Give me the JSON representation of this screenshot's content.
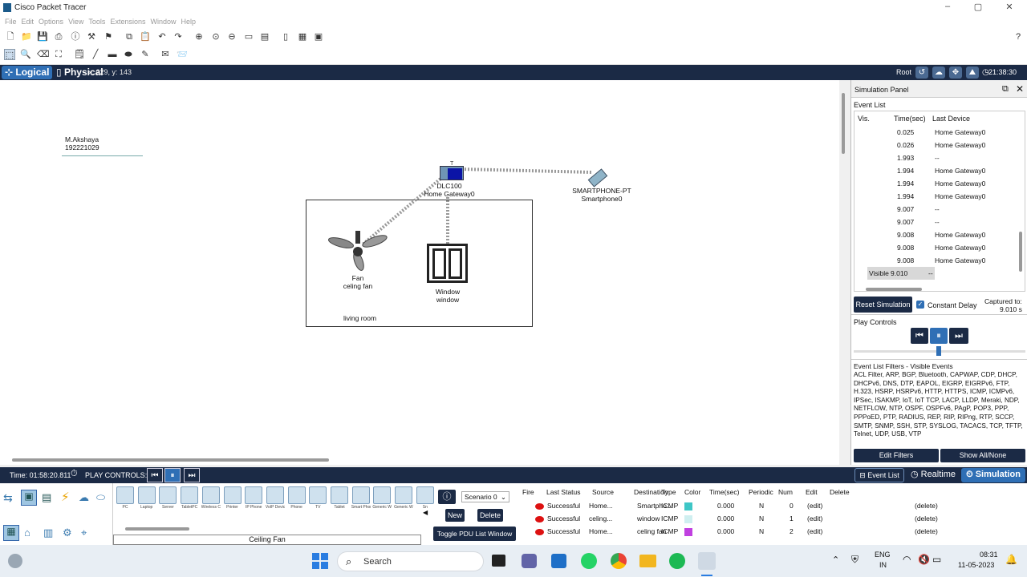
{
  "window": {
    "title": "Cisco Packet Tracer",
    "minimize": "–",
    "maximize": "▢",
    "close": "✕"
  },
  "menu": [
    "File",
    "Edit",
    "Options",
    "View",
    "Tools",
    "Extensions",
    "Window",
    "Help"
  ],
  "help_glyph": "?",
  "workspace_bar": {
    "logical": "Logical",
    "physical": "Physical",
    "coords": "x: 229, y: 143",
    "root": "Root",
    "clock": "21:38:30"
  },
  "canvas": {
    "note_line1": "M.Akshaya",
    "note_line2": "192221029",
    "room_label": "living room",
    "gateway": {
      "model": "DLC100",
      "name": "Home Gateway0"
    },
    "smartphone": {
      "model": "SMARTPHONE-PT",
      "name": "Smartphone0"
    },
    "fan": {
      "model": "Fan",
      "name": "celing fan"
    },
    "window_dev": {
      "model": "Window",
      "name": "window"
    },
    "gateway_label_t": "T"
  },
  "simulation": {
    "panel_title": "Simulation Panel",
    "event_list_title": "Event List",
    "columns": [
      "Vis.",
      "Time(sec)",
      "Last Device"
    ],
    "events": [
      {
        "vis": "",
        "time": "0.025",
        "device": "Home Gateway0"
      },
      {
        "vis": "",
        "time": "0.026",
        "device": "Home Gateway0"
      },
      {
        "vis": "",
        "time": "1.993",
        "device": "--"
      },
      {
        "vis": "",
        "time": "1.994",
        "device": "Home Gateway0"
      },
      {
        "vis": "",
        "time": "1.994",
        "device": "Home Gateway0"
      },
      {
        "vis": "",
        "time": "1.994",
        "device": "Home Gateway0"
      },
      {
        "vis": "",
        "time": "9.007",
        "device": "--"
      },
      {
        "vis": "",
        "time": "9.007",
        "device": "--"
      },
      {
        "vis": "",
        "time": "9.008",
        "device": "Home Gateway0"
      },
      {
        "vis": "",
        "time": "9.008",
        "device": "Home Gateway0"
      },
      {
        "vis": "",
        "time": "9.008",
        "device": "Home Gateway0"
      },
      {
        "vis": "Visible",
        "time": "9.010",
        "device": "--"
      }
    ],
    "reset_label": "Reset Simulation",
    "constant_delay_label": "Constant Delay",
    "captured_label": "Captured to:",
    "captured_value": "9.010 s",
    "play_controls_title": "Play Controls",
    "filters_title": "Event List Filters - Visible Events",
    "filters_text": "ACL Filter, ARP, BGP, Bluetooth, CAPWAP, CDP, DHCP, DHCPv6, DNS, DTP, EAPOL, EIGRP, EIGRPv6, FTP, H.323, HSRP, HSRPv6, HTTP, HTTPS, ICMP, ICMPv6, IPSec, ISAKMP, IoT, IoT TCP, LACP, LLDP, Meraki, NDP, NETFLOW, NTP, OSPF, OSPFv6, PAgP, POP3, PPP, PPPoED, PTP, RADIUS, REP, RIP, RIPng, RTP, SCCP, SMTP, SNMP, SSH, STP, SYSLOG, TACACS, TCP, TFTP, Telnet, UDP, USB, VTP",
    "edit_filters": "Edit Filters",
    "show_all": "Show All/None"
  },
  "statusbar": {
    "time": "Time: 01:58:20.811",
    "play_controls": "PLAY CONTROLS:",
    "event_list": "Event List",
    "realtime": "Realtime",
    "simulation": "Simulation"
  },
  "device_palette": {
    "devices": [
      "PC",
      "Laptop",
      "Server",
      "TabletPC",
      "Wireless Console",
      "Printer",
      "IP Phone",
      "VoIP Device",
      "Phone",
      "TV",
      "Tablet",
      "Smart Phone",
      "Generic Wireless",
      "Generic Wired",
      "Sn"
    ],
    "selected_label": "Ceiling Fan"
  },
  "scenario": {
    "selected": "Scenario 0",
    "new": "New",
    "delete": "Delete",
    "toggle": "Toggle PDU List Window"
  },
  "pdu_table": {
    "columns": [
      "Fire",
      "Last Status",
      "Source",
      "Destination",
      "Type",
      "Color",
      "Time(sec)",
      "Periodic",
      "Num",
      "Edit",
      "Delete"
    ],
    "rows": [
      {
        "status": "Successful",
        "source": "Home...",
        "dest": "Smartpho...",
        "type": "ICMP",
        "color": "#3ec6c6",
        "time": "0.000",
        "periodic": "N",
        "num": "0",
        "edit": "(edit)",
        "delete": "(delete)"
      },
      {
        "status": "Successful",
        "source": "celing...",
        "dest": "window",
        "type": "ICMP",
        "color": "#cfeff0",
        "time": "0.000",
        "periodic": "N",
        "num": "1",
        "edit": "(edit)",
        "delete": "(delete)"
      },
      {
        "status": "Successful",
        "source": "Home...",
        "dest": "celing fan",
        "type": "ICMP",
        "color": "#c040e0",
        "time": "0.000",
        "periodic": "N",
        "num": "2",
        "edit": "(edit)",
        "delete": "(delete)"
      }
    ]
  },
  "taskbar": {
    "search": "Search",
    "lang1": "ENG",
    "lang2": "IN",
    "time": "08:31",
    "date": "11-05-2023"
  }
}
